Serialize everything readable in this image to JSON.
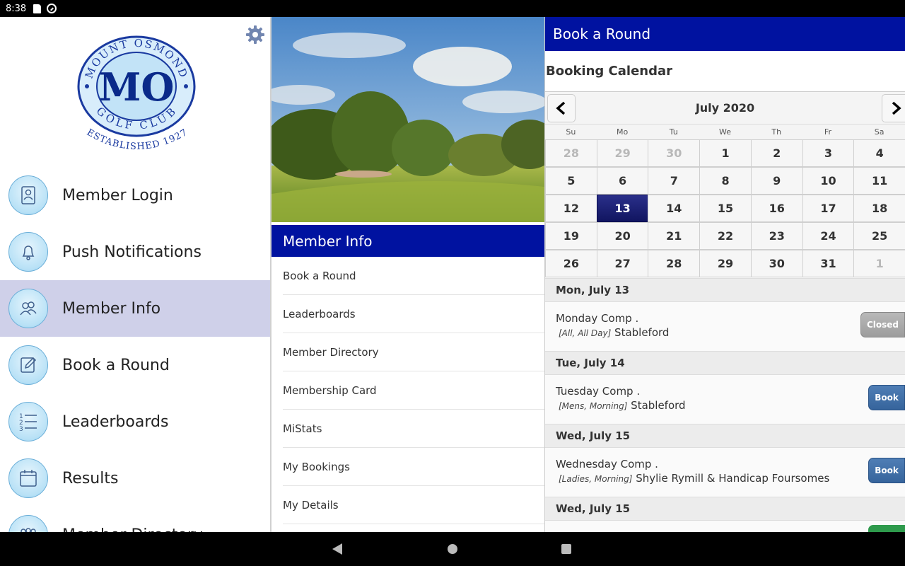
{
  "status_bar": {
    "time": "8:38"
  },
  "drawer": {
    "logo": {
      "ring_text_top": "MOUNT OSMOND",
      "ring_text_bottom": "GOLF CLUB",
      "monogram": "MO",
      "established": "ESTABLISHED 1927"
    },
    "items": [
      {
        "label": "Member Login",
        "icon": "member-login-icon"
      },
      {
        "label": "Push Notifications",
        "icon": "bell-icon"
      },
      {
        "label": "Member Info",
        "icon": "members-icon",
        "active": true
      },
      {
        "label": "Book a Round",
        "icon": "pencil-icon"
      },
      {
        "label": "Leaderboards",
        "icon": "numbered-list-icon"
      },
      {
        "label": "Results",
        "icon": "calendar-icon"
      },
      {
        "label": "Member Directory",
        "icon": "group-icon"
      }
    ]
  },
  "middle": {
    "header": "Member Info",
    "list": [
      "Book a Round",
      "Leaderboards",
      "Member Directory",
      "Membership Card",
      "MiStats",
      "My Bookings",
      "My Details"
    ]
  },
  "right": {
    "header": "Book a Round",
    "calendar_title": "Booking Calendar",
    "month": "July 2020",
    "days_of_week": [
      "Su",
      "Mo",
      "Tu",
      "We",
      "Th",
      "Fr",
      "Sa"
    ],
    "weeks": [
      [
        {
          "d": "28",
          "o": true
        },
        {
          "d": "29",
          "o": true
        },
        {
          "d": "30",
          "o": true
        },
        {
          "d": "1"
        },
        {
          "d": "2"
        },
        {
          "d": "3"
        },
        {
          "d": "4"
        }
      ],
      [
        {
          "d": "5"
        },
        {
          "d": "6"
        },
        {
          "d": "7"
        },
        {
          "d": "8"
        },
        {
          "d": "9"
        },
        {
          "d": "10"
        },
        {
          "d": "11"
        }
      ],
      [
        {
          "d": "12"
        },
        {
          "d": "13",
          "sel": true
        },
        {
          "d": "14"
        },
        {
          "d": "15"
        },
        {
          "d": "16"
        },
        {
          "d": "17"
        },
        {
          "d": "18"
        }
      ],
      [
        {
          "d": "19"
        },
        {
          "d": "20"
        },
        {
          "d": "21"
        },
        {
          "d": "22"
        },
        {
          "d": "23"
        },
        {
          "d": "24"
        },
        {
          "d": "25"
        }
      ],
      [
        {
          "d": "26"
        },
        {
          "d": "27"
        },
        {
          "d": "28"
        },
        {
          "d": "29"
        },
        {
          "d": "30"
        },
        {
          "d": "31"
        },
        {
          "d": "1",
          "o": true
        }
      ]
    ],
    "events": [
      {
        "date": "Mon, July 13",
        "name": "Monday Comp .",
        "tag": "[All, All Day]",
        "format": "Stableford",
        "button": "Closed",
        "button_type": "closed"
      },
      {
        "date": "Tue, July 14",
        "name": "Tuesday Comp .",
        "tag": "[Mens, Morning]",
        "format": "Stableford",
        "button": "Book",
        "button_type": "book"
      },
      {
        "date": "Wed, July 15",
        "name": "Wednesday Comp .",
        "tag": "[Ladies, Morning]",
        "format": "Shylie Rymill & Handicap Foursomes",
        "button": "Book",
        "button_type": "book"
      },
      {
        "date": "Wed, July 15"
      }
    ]
  },
  "colors": {
    "header_blue": "#0012a0",
    "active_item": "#cfd0e9",
    "selected_day": "#1a1f70",
    "book_button": "#3d6ca4",
    "closed_button": "#a8a8a8"
  }
}
